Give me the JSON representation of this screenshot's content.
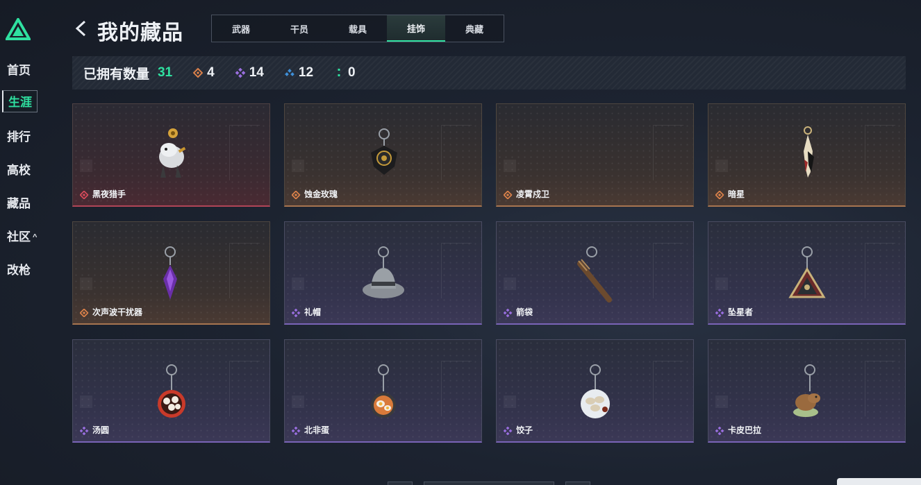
{
  "sidebar": {
    "items": [
      {
        "label": "首页"
      },
      {
        "label": "生涯",
        "active": true
      },
      {
        "label": "排行"
      },
      {
        "label": "高校"
      },
      {
        "label": "藏品"
      },
      {
        "label": "社区",
        "caret": "^"
      },
      {
        "label": "改枪"
      }
    ],
    "logo_icon": "triangle-logo-icon"
  },
  "header": {
    "title": "我的藏品",
    "back_icon": "chevron-left-icon"
  },
  "tabs": [
    {
      "label": "武器"
    },
    {
      "label": "干员"
    },
    {
      "label": "载具"
    },
    {
      "label": "挂饰",
      "active": true
    },
    {
      "label": "典藏"
    }
  ],
  "stats": {
    "label": "已拥有数量",
    "total": "31",
    "counts": [
      {
        "rarity": "orange",
        "value": "4",
        "color": "#d9804a"
      },
      {
        "rarity": "purple",
        "value": "14",
        "color": "#9a6fe0"
      },
      {
        "rarity": "blue",
        "value": "12",
        "color": "#3e8fd8"
      },
      {
        "rarity": "green",
        "value": "0",
        "color": "#2fe0a0"
      }
    ]
  },
  "items": [
    {
      "name": "黑夜猎手",
      "rarity": "red"
    },
    {
      "name": "蚀金玫瑰",
      "rarity": "orange"
    },
    {
      "name": "凌霄戍卫",
      "rarity": "orange"
    },
    {
      "name": "暗星",
      "rarity": "orange"
    },
    {
      "name": "次声波干扰器",
      "rarity": "orange"
    },
    {
      "name": "礼帽",
      "rarity": "purple"
    },
    {
      "name": "箭袋",
      "rarity": "purple"
    },
    {
      "name": "坠星者",
      "rarity": "purple"
    },
    {
      "name": "汤圆",
      "rarity": "purple"
    },
    {
      "name": "北非蛋",
      "rarity": "purple"
    },
    {
      "name": "饺子",
      "rarity": "purple"
    },
    {
      "name": "卡皮巴拉",
      "rarity": "purple"
    }
  ],
  "colors": {
    "accent": "#2fe0a0",
    "red_rarity": "#d64a5a",
    "orange_rarity": "#d9804a",
    "purple_rarity": "#9a6fe0"
  }
}
